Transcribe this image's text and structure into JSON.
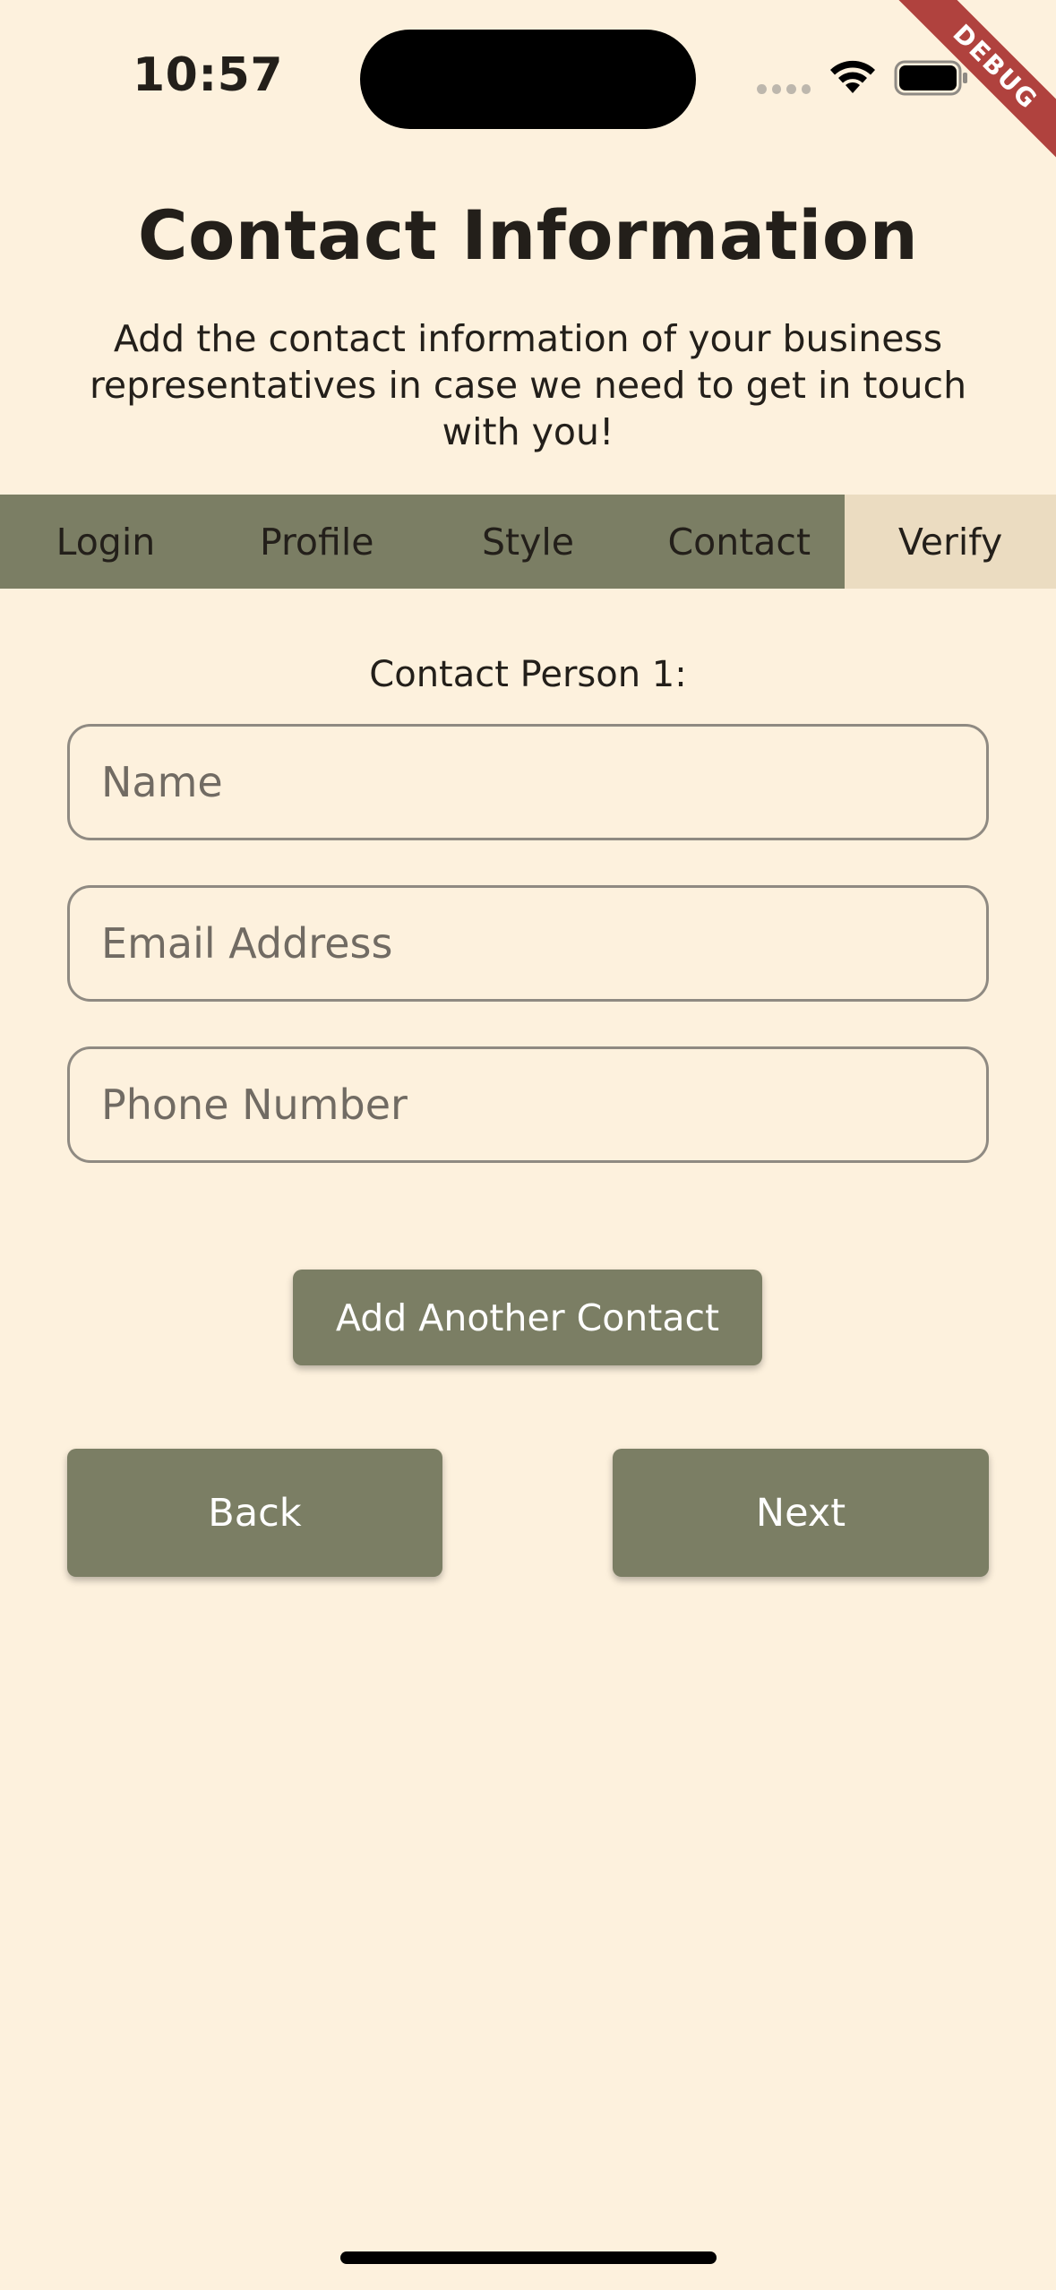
{
  "status_bar": {
    "time": "10:57",
    "icons": [
      "cellular-signal-icon",
      "wifi-icon",
      "battery-icon"
    ]
  },
  "debug_banner": "DEBUG",
  "header": {
    "title": "Contact Information",
    "subtitle": "Add the contact information of your business representatives in case we need to get in touch with you!"
  },
  "tabs": [
    {
      "label": "Login",
      "active": false
    },
    {
      "label": "Profile",
      "active": false
    },
    {
      "label": "Style",
      "active": false
    },
    {
      "label": "Contact",
      "active": false
    },
    {
      "label": "Verify",
      "active": true
    }
  ],
  "form": {
    "section_label": "Contact Person 1:",
    "name": {
      "value": "",
      "placeholder": "Name"
    },
    "email": {
      "value": "",
      "placeholder": "Email Address"
    },
    "phone": {
      "value": "",
      "placeholder": "Phone Number"
    }
  },
  "buttons": {
    "add_contact": "Add Another Contact",
    "back": "Back",
    "next": "Next"
  },
  "colors": {
    "background": "#FDF1DD",
    "accent": "#7B7E64",
    "active_tab": "#EBDCC1",
    "text": "#231F1A",
    "debug_banner": "#B0423E"
  }
}
